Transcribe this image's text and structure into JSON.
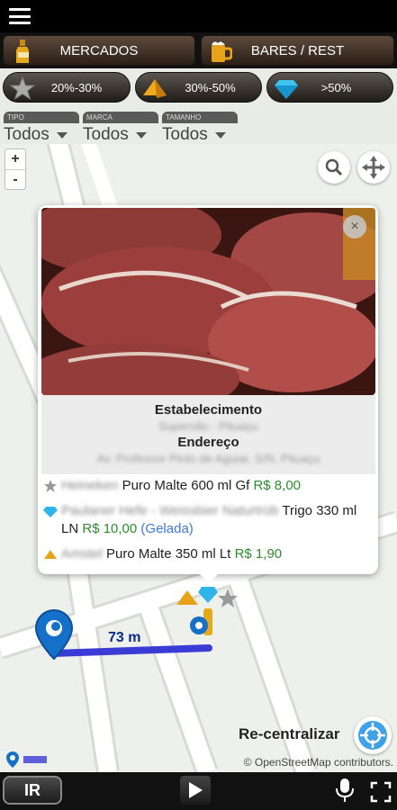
{
  "topbar": {
    "menu_icon": "hamburger-icon"
  },
  "categories": [
    {
      "label": "MERCADOS",
      "icon": "beer-bottle-icon"
    },
    {
      "label": "BARES / REST",
      "icon": "beer-mug-icon"
    }
  ],
  "discount_filters": [
    {
      "label": "20%-30%",
      "icon": "star-icon"
    },
    {
      "label": "30%-50%",
      "icon": "gold-pyramid-icon"
    },
    {
      "label": ">50%",
      "icon": "diamond-icon"
    }
  ],
  "dropdowns": [
    {
      "tag": "TIPO",
      "value": "Todos"
    },
    {
      "tag": "MARCA",
      "value": "Todos"
    },
    {
      "tag": "TAMANHO",
      "value": "Todos"
    }
  ],
  "map": {
    "zoom_in": "+",
    "zoom_out": "-",
    "distance_label": "73 m",
    "recenter_label": "Re-centralizar",
    "credit": "© OpenStreetMap contributors."
  },
  "popup": {
    "close": "×",
    "establishment_label": "Estabelecimento",
    "establishment_value": "Supersão - Pituaçu",
    "address_label": "Endereço",
    "address_value": "Av. Professor Pinto de Aguiar, S/N, Pituaçu",
    "items": [
      {
        "icon": "star-icon",
        "brand": "Heineken",
        "desc": "Puro Malte 600 ml Gf",
        "price": "R$ 8,00",
        "note": ""
      },
      {
        "icon": "diamond-icon",
        "brand": "Paulaner Hefe - Weissbier Naturtrüb",
        "desc": "Trigo 330 ml LN",
        "price": "R$ 10,00",
        "note": "(Gelada)"
      },
      {
        "icon": "gold-pyramid-icon",
        "brand": "Amstel",
        "desc": "Puro Malte 350 ml Lt",
        "price": "R$ 1,90",
        "note": ""
      }
    ]
  },
  "bottombar": {
    "go_label": "IR"
  },
  "colors": {
    "price": "#2e8b2e",
    "route": "#3b3bd6",
    "note": "#3a7bd5"
  }
}
